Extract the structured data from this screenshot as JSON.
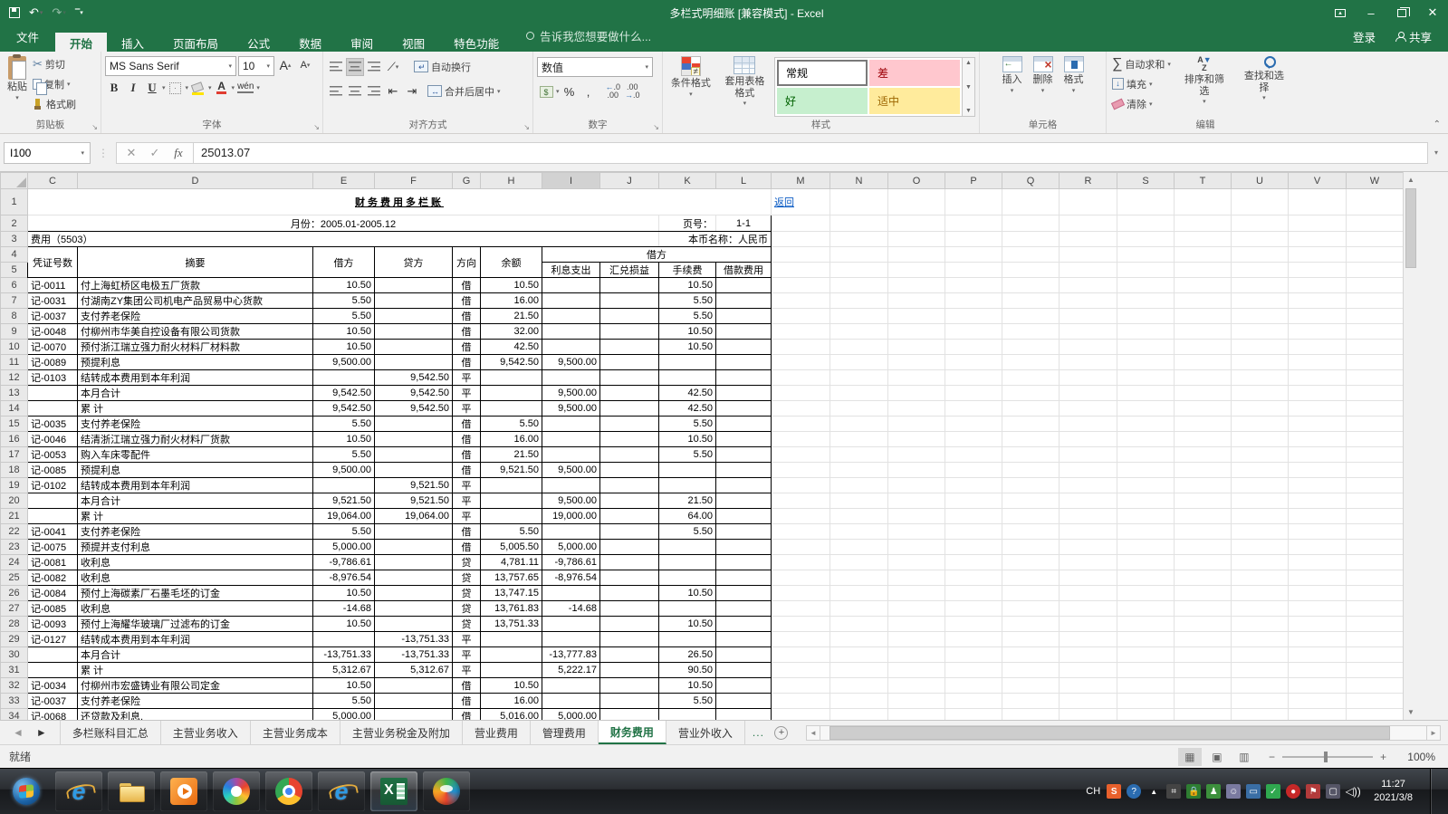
{
  "title_bar": {
    "title": "多栏式明细账  [兼容模式] - Excel"
  },
  "ribbon_tabs": {
    "file": "文件",
    "tabs": [
      "开始",
      "插入",
      "页面布局",
      "公式",
      "数据",
      "审阅",
      "视图",
      "特色功能"
    ],
    "active": "开始",
    "tell_me": "告诉我您想要做什么...",
    "sign_in": "登录",
    "share": "共享"
  },
  "ribbon": {
    "clipboard": {
      "label": "剪贴板",
      "paste": "粘贴",
      "cut": "剪切",
      "copy": "复制",
      "format_painter": "格式刷"
    },
    "font": {
      "label": "字体",
      "font_name": "MS Sans Serif",
      "font_size": "10",
      "bold": "B",
      "italic": "I",
      "underline": "U",
      "phonetic": "wén"
    },
    "alignment": {
      "label": "对齐方式",
      "wrap_text": "自动换行",
      "merge_center": "合并后居中"
    },
    "number": {
      "label": "数字",
      "format": "数值",
      "percent": "%",
      "comma": ","
    },
    "styles": {
      "label": "样式",
      "conditional": "条件格式",
      "format_table": "套用表格格式",
      "gallery": [
        {
          "name": "常规",
          "bg": "#ffffff",
          "fg": "#000000"
        },
        {
          "name": "差",
          "bg": "#ffc7ce",
          "fg": "#9c0006"
        },
        {
          "name": "好",
          "bg": "#c6efce",
          "fg": "#006100"
        },
        {
          "name": "适中",
          "bg": "#ffeb9c",
          "fg": "#9c6500"
        }
      ]
    },
    "cells": {
      "label": "单元格",
      "insert": "插入",
      "delete": "删除",
      "format": "格式"
    },
    "editing": {
      "label": "编辑",
      "autosum": "自动求和",
      "fill": "填充",
      "clear": "清除",
      "sort": "排序和筛选",
      "find": "查找和选择"
    }
  },
  "formula_bar": {
    "name_box": "I100",
    "value": "25013.07",
    "fx": "fx"
  },
  "grid": {
    "columns": [
      "C",
      "D",
      "E",
      "F",
      "G",
      "H",
      "I",
      "J",
      "K",
      "L",
      "M",
      "N",
      "O",
      "P",
      "Q",
      "R",
      "S",
      "T",
      "U",
      "V",
      "W"
    ],
    "selected_column": "I",
    "row_count": 34,
    "title": "财务费用多栏账",
    "back_link": "返回",
    "month_line": "月份：2005.01-2005.12",
    "page_label": "页号：",
    "page_value": "1-1",
    "account_line": "费用（5503）",
    "currency_line": "本币名称：人民币",
    "header": {
      "voucher": "凭证号数",
      "summary": "摘要",
      "debit": "借方",
      "credit": "贷方",
      "direction": "方向",
      "balance": "余额",
      "debit_group": "借方",
      "subcolumns": [
        "利息支出",
        "汇兑损益",
        "手续费",
        "借款费用"
      ]
    },
    "rows": [
      [
        "记-0011",
        "付上海虹桥区电极五厂货款",
        "10.50",
        "",
        "借",
        "10.50",
        "",
        "",
        "10.50",
        ""
      ],
      [
        "记-0031",
        "付湖南ZY集团公司机电产品贸易中心货款",
        "5.50",
        "",
        "借",
        "16.00",
        "",
        "",
        "5.50",
        ""
      ],
      [
        "记-0037",
        "支付养老保险",
        "5.50",
        "",
        "借",
        "21.50",
        "",
        "",
        "5.50",
        ""
      ],
      [
        "记-0048",
        "付柳州市华美自控设备有限公司货款",
        "10.50",
        "",
        "借",
        "32.00",
        "",
        "",
        "10.50",
        ""
      ],
      [
        "记-0070",
        "预付浙江瑞立强力耐火材料厂材料款",
        "10.50",
        "",
        "借",
        "42.50",
        "",
        "",
        "10.50",
        ""
      ],
      [
        "记-0089",
        "预提利息",
        "9,500.00",
        "",
        "借",
        "9,542.50",
        "9,500.00",
        "",
        "",
        ""
      ],
      [
        "记-0103",
        "结转成本费用到本年利润",
        "",
        "9,542.50",
        "平",
        "",
        "",
        "",
        "",
        ""
      ],
      [
        "",
        "本月合计",
        "9,542.50",
        "9,542.50",
        "平",
        "",
        "9,500.00",
        "",
        "42.50",
        ""
      ],
      [
        "",
        "累  计",
        "9,542.50",
        "9,542.50",
        "平",
        "",
        "9,500.00",
        "",
        "42.50",
        ""
      ],
      [
        "记-0035",
        "支付养老保险",
        "5.50",
        "",
        "借",
        "5.50",
        "",
        "",
        "5.50",
        ""
      ],
      [
        "记-0046",
        "结清浙江瑞立强力耐火材料厂货款",
        "10.50",
        "",
        "借",
        "16.00",
        "",
        "",
        "10.50",
        ""
      ],
      [
        "记-0053",
        "购入车床零配件",
        "5.50",
        "",
        "借",
        "21.50",
        "",
        "",
        "5.50",
        ""
      ],
      [
        "记-0085",
        "预提利息",
        "9,500.00",
        "",
        "借",
        "9,521.50",
        "9,500.00",
        "",
        "",
        ""
      ],
      [
        "记-0102",
        "结转成本费用到本年利润",
        "",
        "9,521.50",
        "平",
        "",
        "",
        "",
        "",
        ""
      ],
      [
        "",
        "本月合计",
        "9,521.50",
        "9,521.50",
        "平",
        "",
        "9,500.00",
        "",
        "21.50",
        ""
      ],
      [
        "",
        "累  计",
        "19,064.00",
        "19,064.00",
        "平",
        "",
        "19,000.00",
        "",
        "64.00",
        ""
      ],
      [
        "记-0041",
        "支付养老保险",
        "5.50",
        "",
        "借",
        "5.50",
        "",
        "",
        "5.50",
        ""
      ],
      [
        "记-0075",
        "预提并支付利息",
        "5,000.00",
        "",
        "借",
        "5,005.50",
        "5,000.00",
        "",
        "",
        ""
      ],
      [
        "记-0081",
        "收利息",
        "-9,786.61",
        "",
        "贷",
        "4,781.11",
        "-9,786.61",
        "",
        "",
        ""
      ],
      [
        "记-0082",
        "收利息",
        "-8,976.54",
        "",
        "贷",
        "13,757.65",
        "-8,976.54",
        "",
        "",
        ""
      ],
      [
        "记-0084",
        "预付上海碳素厂石墨毛坯的订金",
        "10.50",
        "",
        "贷",
        "13,747.15",
        "",
        "",
        "10.50",
        ""
      ],
      [
        "记-0085",
        "收利息",
        "-14.68",
        "",
        "贷",
        "13,761.83",
        "-14.68",
        "",
        "",
        ""
      ],
      [
        "记-0093",
        "预付上海耀华玻璃厂过滤布的订金",
        "10.50",
        "",
        "贷",
        "13,751.33",
        "",
        "",
        "10.50",
        ""
      ],
      [
        "记-0127",
        "结转成本费用到本年利润",
        "",
        "-13,751.33",
        "平",
        "",
        "",
        "",
        "",
        ""
      ],
      [
        "",
        "本月合计",
        "-13,751.33",
        "-13,751.33",
        "平",
        "",
        "-13,777.83",
        "",
        "26.50",
        ""
      ],
      [
        "",
        "累  计",
        "5,312.67",
        "5,312.67",
        "平",
        "",
        "5,222.17",
        "",
        "90.50",
        ""
      ],
      [
        "记-0034",
        "付柳州市宏盛铸业有限公司定金",
        "10.50",
        "",
        "借",
        "10.50",
        "",
        "",
        "10.50",
        ""
      ],
      [
        "记-0037",
        "支付养老保险",
        "5.50",
        "",
        "借",
        "16.00",
        "",
        "",
        "5.50",
        ""
      ],
      [
        "记-0068",
        "还贷款及利息.",
        "5,000.00",
        "",
        "借",
        "5,016.00",
        "5,000.00",
        "",
        "",
        ""
      ]
    ]
  },
  "sheet_bar": {
    "tabs": [
      "多栏账科目汇总",
      "主营业务收入",
      "主营业务成本",
      "主营业务税金及附加",
      "营业费用",
      "管理费用",
      "财务费用",
      "营业外收入"
    ],
    "active": "财务费用",
    "overflow": "..."
  },
  "status_bar": {
    "ready": "就绪",
    "zoom": "100%"
  },
  "taskbar": {
    "buttons": [
      "start",
      "ie",
      "explorer",
      "media-player",
      "pinwheel-browser",
      "chrome",
      "ie",
      "excel",
      "sphere-browser"
    ],
    "active": "excel",
    "tray_label": "CH",
    "tray_icons": [
      "sogou-input",
      "help",
      "expand-arrow",
      "snip",
      "lock-safe",
      "user-green",
      "user-search",
      "monitor-app",
      "check-green",
      "phone-red",
      "flag-error",
      "network",
      "volume"
    ],
    "clock_time": "11:27",
    "clock_date": "2021/3/8"
  },
  "accent_colors": {
    "excel_green": "#217346",
    "bad_bg": "#ffc7ce",
    "good_bg": "#c6efce",
    "neutral_bg": "#ffeb9c"
  }
}
